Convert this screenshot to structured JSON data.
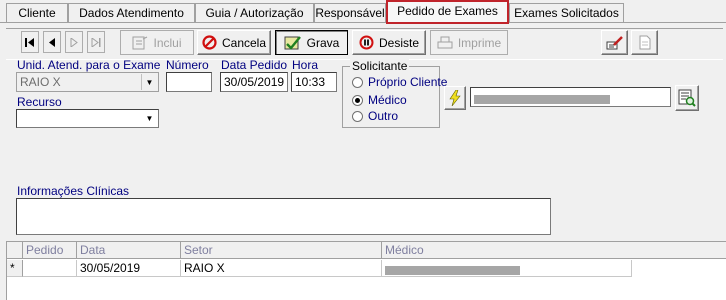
{
  "tabs": [
    {
      "label": "Cliente",
      "active": false
    },
    {
      "label": "Dados Atendimento",
      "active": false
    },
    {
      "label": "Guia / Autorização",
      "active": false
    },
    {
      "label": "Responsável",
      "active": false
    },
    {
      "label": "Pedido de Exames",
      "active": true
    },
    {
      "label": "Exames Solicitados",
      "active": false
    }
  ],
  "toolbar": {
    "nav": [
      "first",
      "prev",
      "next",
      "last"
    ],
    "incluir": "Inclui",
    "cancela": "Cancela",
    "grava": "Grava",
    "desiste": "Desiste",
    "imprime": "Imprime"
  },
  "form": {
    "unid_label": "Unid. Atend. para o Exame",
    "unid_value": "RAIO X",
    "numero_label": "Número",
    "numero_value": "",
    "data_label": "Data Pedido",
    "data_value": "30/05/2019",
    "hora_label": "Hora",
    "hora_value": "10:33",
    "recurso_label": "Recurso",
    "recurso_value": "",
    "info_label": "Informações Clínicas",
    "info_value": ""
  },
  "solicitante": {
    "legend": "Solicitante",
    "options": [
      {
        "label": "Próprio Cliente",
        "selected": false
      },
      {
        "label": "Médico",
        "selected": true
      },
      {
        "label": "Outro",
        "selected": false
      }
    ],
    "name_value": "[redacted]"
  },
  "grid": {
    "columns": [
      "Pedido",
      "Data",
      "Setor",
      "Médico"
    ],
    "rows": [
      {
        "marker": "*",
        "pedido": "",
        "data": "30/05/2019",
        "setor": "RAIO X",
        "medico": "[redacted]"
      }
    ]
  },
  "colors": {
    "active_tab_border": "#c0242b",
    "label_text": "#000080",
    "grid_header_text": "#7f7f9f"
  }
}
